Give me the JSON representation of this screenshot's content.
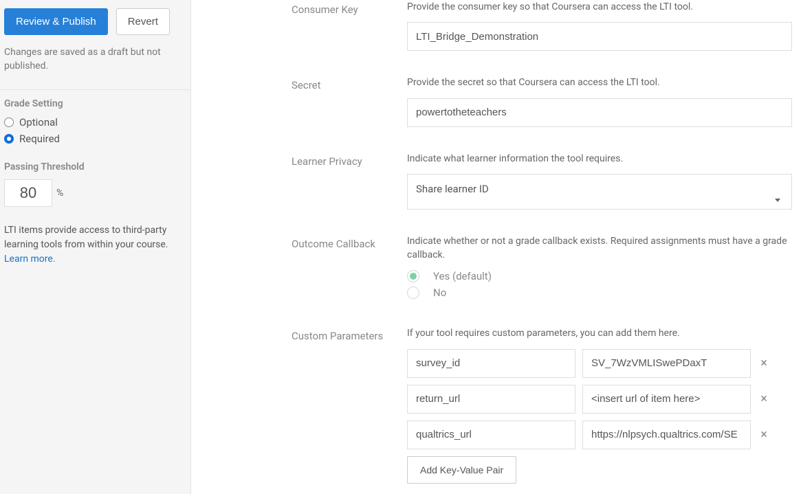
{
  "sidebar": {
    "review_publish_label": "Review & Publish",
    "revert_label": "Revert",
    "draft_note": "Changes are saved as a draft but not published.",
    "grade_setting_heading": "Grade Setting",
    "grade_options": {
      "optional": "Optional",
      "required": "Required",
      "selected": "required"
    },
    "passing_threshold_heading": "Passing Threshold",
    "passing_threshold_value": "80",
    "passing_threshold_pct": "%",
    "lti_help_text": "LTI items provide access to third-party learning tools from within your course. ",
    "learn_more": "Learn more."
  },
  "form": {
    "consumer_key": {
      "label": "Consumer Key",
      "help": "Provide the consumer key so that Coursera can access the LTI tool.",
      "value": "LTI_Bridge_Demonstration"
    },
    "secret": {
      "label": "Secret",
      "help": "Provide the secret so that Coursera can access the LTI tool.",
      "value": "powertotheteachers"
    },
    "learner_privacy": {
      "label": "Learner Privacy",
      "help": "Indicate what learner information the tool requires.",
      "selected": "Share learner ID"
    },
    "outcome_callback": {
      "label": "Outcome Callback",
      "help": "Indicate whether or not a grade callback exists. Required assignments must have a grade callback.",
      "yes_label": "Yes (default)",
      "no_label": "No",
      "selected": "yes"
    },
    "custom_params": {
      "label": "Custom Parameters",
      "help": "If your tool requires custom parameters, you can add them here.",
      "params": [
        {
          "key": "survey_id",
          "value": "SV_7WzVMLISwePDaxT"
        },
        {
          "key": "return_url",
          "value": "<insert url of item here>"
        },
        {
          "key": "qualtrics_url",
          "value": "https://nlpsych.qualtrics.com/SE"
        }
      ],
      "add_button": "Add Key-Value Pair"
    }
  }
}
